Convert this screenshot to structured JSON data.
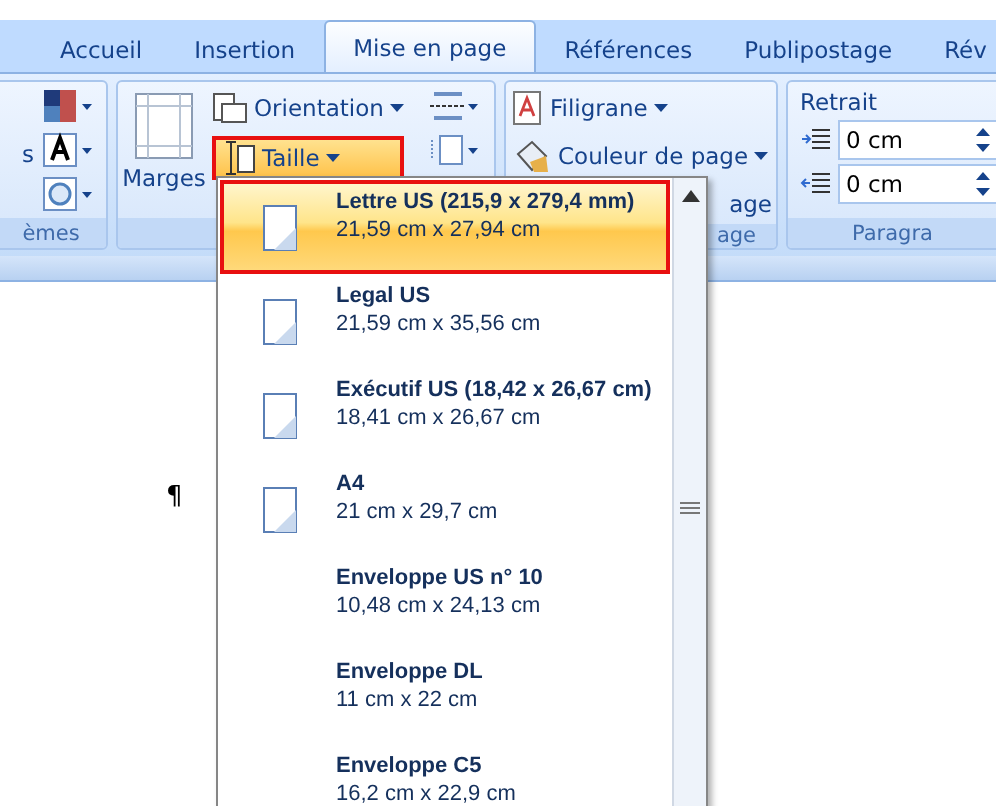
{
  "tabs": [
    {
      "label": "Accueil",
      "selected": false
    },
    {
      "label": "Insertion",
      "selected": false
    },
    {
      "label": "Mise en page",
      "selected": true
    },
    {
      "label": "Références",
      "selected": false
    },
    {
      "label": "Publipostage",
      "selected": false
    },
    {
      "label": "Rév",
      "selected": false
    }
  ],
  "themes_group": {
    "button_fragment": "s",
    "label": "èmes"
  },
  "page_setup_group": {
    "margins": "Marges",
    "orientation": "Orientation",
    "size": {
      "label": "Taille",
      "highlighted": true
    }
  },
  "background_group": {
    "watermark": "Filigrane",
    "page_color": "Couleur de page",
    "borders_fragment": "age",
    "label": "age"
  },
  "paragraph_group": {
    "indent_title": "Retrait",
    "fields": [
      {
        "value": "0 cm"
      },
      {
        "value": "0 cm"
      }
    ],
    "label": "Paragra"
  },
  "document": {
    "paragraph_mark": "¶"
  },
  "size_menu": {
    "items": [
      {
        "kind": "sheet",
        "title": "Lettre US (215,9 x 279,4 mm)",
        "dimensions": "21,59 cm x 27,94 cm",
        "selected": true
      },
      {
        "kind": "sheet",
        "title": "Legal US",
        "dimensions": "21,59 cm x 35,56 cm",
        "selected": false
      },
      {
        "kind": "sheet",
        "title": "Exécutif US (18,42 x 26,67 cm)",
        "dimensions": "18,41 cm x 26,67 cm",
        "selected": false
      },
      {
        "kind": "sheet",
        "title": "A4",
        "dimensions": "21 cm x 29,7 cm",
        "selected": false
      },
      {
        "kind": "envelope",
        "title": "Enveloppe US n° 10",
        "dimensions": "10,48 cm x 24,13 cm",
        "selected": false
      },
      {
        "kind": "envelope",
        "title": "Enveloppe DL",
        "dimensions": "11 cm x 22 cm",
        "selected": false
      },
      {
        "kind": "envelope",
        "title": "Enveloppe C5",
        "dimensions": "16,2 cm x 22,9 cm",
        "selected": false
      }
    ]
  }
}
